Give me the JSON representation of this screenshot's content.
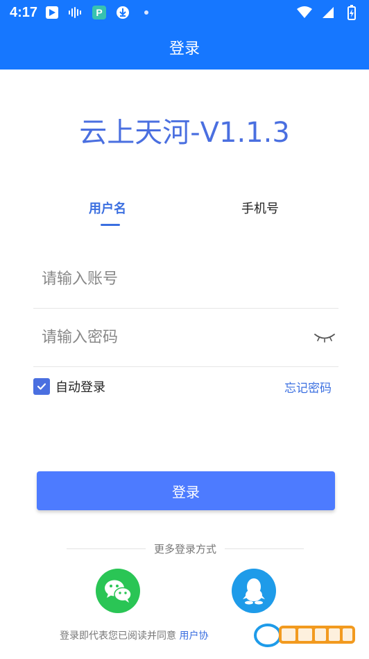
{
  "status_bar": {
    "time": "4:17",
    "icons_left": [
      "play-store-icon",
      "audio-wave-icon",
      "app-p-icon",
      "download-icon",
      "dot-icon"
    ],
    "icons_right": [
      "wifi-icon",
      "signal-icon",
      "battery-charging-icon"
    ]
  },
  "app_bar": {
    "title": "登录"
  },
  "app_title": "云上天河-V1.1.3",
  "tabs": [
    {
      "label": "用户名",
      "active": true
    },
    {
      "label": "手机号",
      "active": false
    }
  ],
  "form": {
    "account_placeholder": "请输入账号",
    "password_placeholder": "请输入密码"
  },
  "options": {
    "auto_login_label": "自动登录",
    "auto_login_checked": true,
    "forgot_password": "忘记密码"
  },
  "login_button": "登录",
  "more_login": "更多登录方式",
  "social": [
    "wechat-icon",
    "qq-icon"
  ],
  "agreement": {
    "text": "登录即代表您已阅读并同意",
    "link": "用户协"
  },
  "colors": {
    "primary": "#1677ff",
    "accent": "#4a6fe0",
    "button": "#4d7bff",
    "wechat": "#2ac555",
    "qq": "#1e9be9"
  }
}
